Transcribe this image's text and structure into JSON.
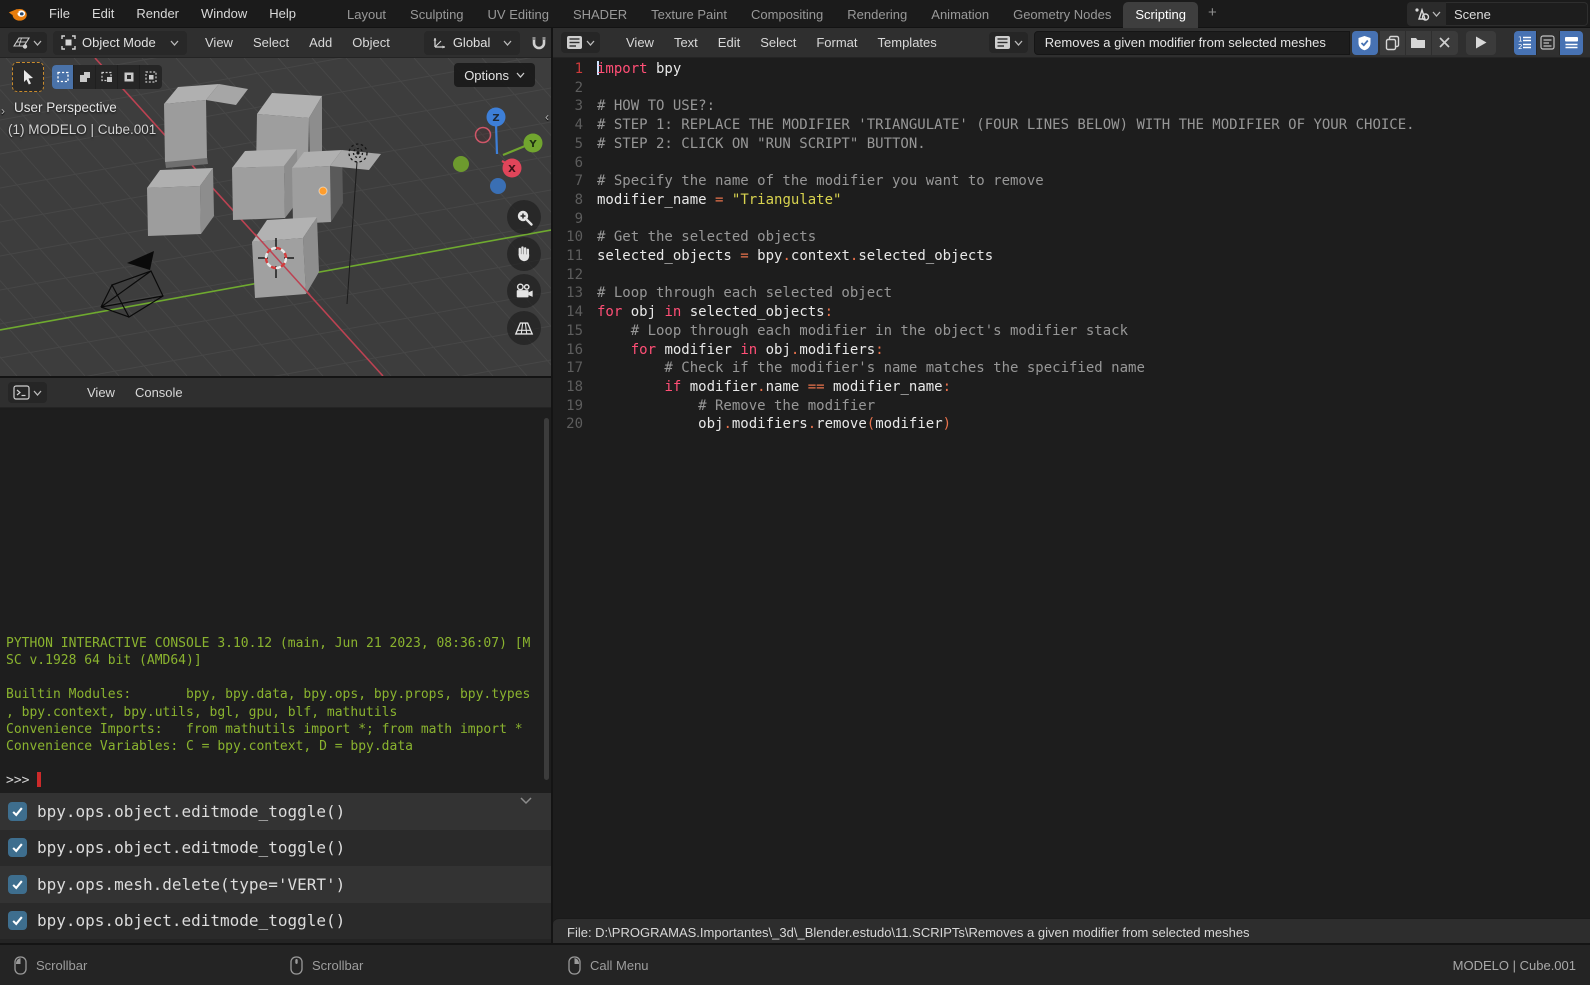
{
  "topbar": {
    "menus": [
      "File",
      "Edit",
      "Render",
      "Window",
      "Help"
    ],
    "tabs": [
      "Layout",
      "Sculpting",
      "UV Editing",
      "SHADER",
      "Texture Paint",
      "Compositing",
      "Rendering",
      "Animation",
      "Geometry Nodes",
      "Scripting"
    ],
    "active_tab": "Scripting",
    "new_tab_label": "+",
    "scene_name": "Scene"
  },
  "viewport": {
    "mode": "Object Mode",
    "menus": [
      "View",
      "Select",
      "Add",
      "Object"
    ],
    "orientation": "Global",
    "options_label": "Options",
    "perspective_label": "User Perspective",
    "active_object_label": "(1) MODELO | Cube.001",
    "gizmo_axes": [
      "X",
      "Y",
      "Z"
    ]
  },
  "console": {
    "menus": [
      "View",
      "Console"
    ],
    "lines": [
      "PYTHON INTERACTIVE CONSOLE 3.10.12 (main, Jun 21 2023, 08:36:07) [M",
      "SC v.1928 64 bit (AMD64)]",
      "",
      "Builtin Modules:       bpy, bpy.data, bpy.ops, bpy.props, bpy.types",
      ", bpy.context, bpy.utils, bgl, gpu, blf, mathutils",
      "Convenience Imports:   from mathutils import *; from math import *",
      "Convenience Variables: C = bpy.context, D = bpy.data"
    ],
    "prompt": ">>> "
  },
  "info": {
    "rows": [
      "bpy.ops.object.editmode_toggle()",
      "bpy.ops.object.editmode_toggle()",
      "bpy.ops.mesh.delete(type='VERT')",
      "bpy.ops.object.editmode_toggle()"
    ]
  },
  "text_editor": {
    "menus": [
      "View",
      "Text",
      "Edit",
      "Select",
      "Format",
      "Templates"
    ],
    "datablock_name": "Removes a given modifier from selected meshes",
    "footer_path": "File: D:\\PROGRAMAS.Importantes\\_3d\\_Blender.estudo\\11.SCRIPTs\\Removes a given modifier from selected meshes",
    "code": [
      {
        "n": 1,
        "t": [
          [
            "kw",
            "import"
          ],
          [
            "tx",
            " bpy"
          ]
        ]
      },
      {
        "n": 2,
        "t": []
      },
      {
        "n": 3,
        "t": [
          [
            "cm",
            "# HOW TO USE?:"
          ]
        ]
      },
      {
        "n": 4,
        "t": [
          [
            "cm",
            "# STEP 1: REPLACE THE MODIFIER 'TRIANGULATE' (FOUR LINES BELOW) WITH THE MODIFIER OF YOUR CHOICE."
          ]
        ]
      },
      {
        "n": 5,
        "t": [
          [
            "cm",
            "# STEP 2: CLICK ON \"RUN SCRIPT\" BUTTON."
          ]
        ]
      },
      {
        "n": 6,
        "t": []
      },
      {
        "n": 7,
        "t": [
          [
            "cm",
            "# Specify the name of the modifier you want to remove"
          ]
        ]
      },
      {
        "n": 8,
        "t": [
          [
            "tx",
            "modifier_name "
          ],
          [
            "op",
            "="
          ],
          [
            "tx",
            " "
          ],
          [
            "st",
            "\"Triangulate\""
          ]
        ]
      },
      {
        "n": 9,
        "t": []
      },
      {
        "n": 10,
        "t": [
          [
            "cm",
            "# Get the selected objects"
          ]
        ]
      },
      {
        "n": 11,
        "t": [
          [
            "tx",
            "selected_objects "
          ],
          [
            "op",
            "="
          ],
          [
            "tx",
            " bpy"
          ],
          [
            "op",
            "."
          ],
          [
            "tx",
            "context"
          ],
          [
            "op",
            "."
          ],
          [
            "tx",
            "selected_objects"
          ]
        ]
      },
      {
        "n": 12,
        "t": []
      },
      {
        "n": 13,
        "t": [
          [
            "cm",
            "# Loop through each selected object"
          ]
        ]
      },
      {
        "n": 14,
        "t": [
          [
            "kw",
            "for"
          ],
          [
            "tx",
            " obj "
          ],
          [
            "kw",
            "in"
          ],
          [
            "tx",
            " selected_objects"
          ],
          [
            "op",
            ":"
          ]
        ]
      },
      {
        "n": 15,
        "t": [
          [
            "cm",
            "    # Loop through each modifier in the object's modifier stack"
          ]
        ]
      },
      {
        "n": 16,
        "t": [
          [
            "tx",
            "    "
          ],
          [
            "kw",
            "for"
          ],
          [
            "tx",
            " modifier "
          ],
          [
            "kw",
            "in"
          ],
          [
            "tx",
            " obj"
          ],
          [
            "op",
            "."
          ],
          [
            "tx",
            "modifiers"
          ],
          [
            "op",
            ":"
          ]
        ]
      },
      {
        "n": 17,
        "t": [
          [
            "cm",
            "        # Check if the modifier's name matches the specified name"
          ]
        ]
      },
      {
        "n": 18,
        "t": [
          [
            "tx",
            "        "
          ],
          [
            "kw",
            "if"
          ],
          [
            "tx",
            " modifier"
          ],
          [
            "op",
            "."
          ],
          [
            "tx",
            "name "
          ],
          [
            "op",
            "=="
          ],
          [
            "tx",
            " modifier_name"
          ],
          [
            "op",
            ":"
          ]
        ]
      },
      {
        "n": 19,
        "t": [
          [
            "cm",
            "            # Remove the modifier"
          ]
        ]
      },
      {
        "n": 20,
        "t": [
          [
            "tx",
            "            obj"
          ],
          [
            "op",
            "."
          ],
          [
            "tx",
            "modifiers"
          ],
          [
            "op",
            "."
          ],
          [
            "tx",
            "remove"
          ],
          [
            "op",
            "("
          ],
          [
            "tx",
            "modifier"
          ],
          [
            "op",
            ")"
          ]
        ]
      }
    ]
  },
  "statusbar": {
    "items": [
      {
        "icon": "mouse-left-icon",
        "label": "Scrollbar"
      },
      {
        "icon": "mouse-middle-icon",
        "label": "Scrollbar"
      },
      {
        "icon": "mouse-right-icon",
        "label": "Call Menu"
      }
    ],
    "right": "MODELO | Cube.001"
  },
  "colors": {
    "accent_blue": "#4772b3",
    "console_green": "#8ab32f",
    "keyword": "#ff4f76",
    "operator": "#e8724c",
    "string": "#d8d34f",
    "comment": "#979797",
    "cursor_red": "#cc2a2a"
  },
  "icons": [
    "blender-logo",
    "editor-type-3dview-icon",
    "editor-type-text-icon",
    "editor-type-console-icon",
    "object-mode-icon",
    "orientation-icon",
    "snap-magnet-icon",
    "select-cursor-icon",
    "select-box-icon",
    "options-chevron-icon",
    "zoom-icon",
    "pan-hand-icon",
    "camera-view-icon",
    "ortho-grid-icon",
    "fake-user-shield-icon",
    "copy-icon",
    "folder-open-icon",
    "close-icon",
    "run-script-play-icon",
    "line-numbers-icon",
    "word-wrap-icon",
    "syntax-highlight-icon",
    "checkbox-check-icon",
    "mouse-left-icon",
    "mouse-middle-icon",
    "mouse-right-icon",
    "scene-icon"
  ]
}
